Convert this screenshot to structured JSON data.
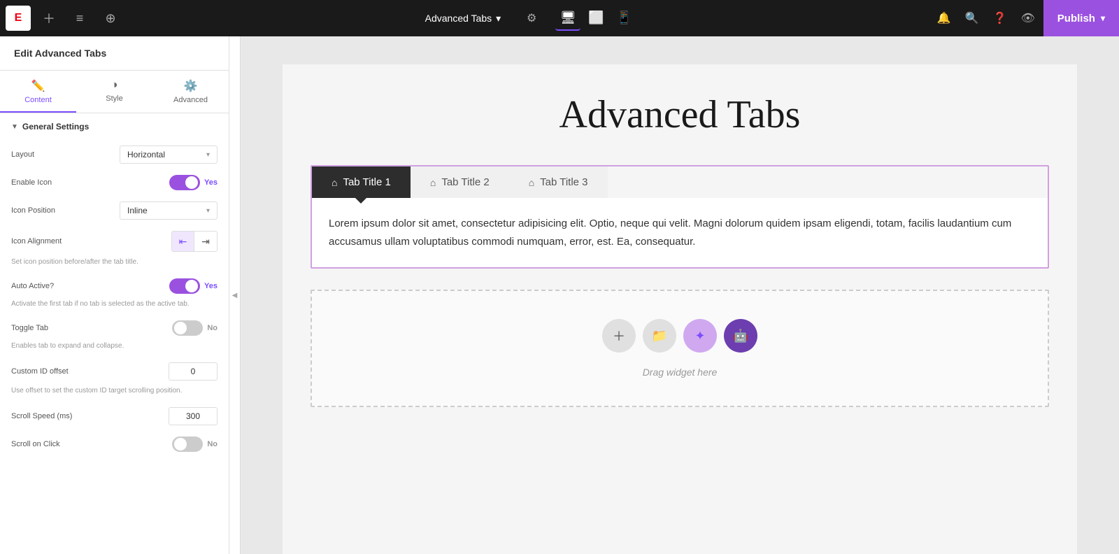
{
  "topbar": {
    "logo": "E",
    "title": "Advanced Tabs",
    "publish_label": "Publish",
    "devices": [
      "desktop",
      "tablet",
      "mobile"
    ]
  },
  "sidebar": {
    "title": "Edit Advanced Tabs",
    "tabs": [
      {
        "id": "content",
        "label": "Content",
        "icon": "✏️"
      },
      {
        "id": "style",
        "label": "Style",
        "icon": "◑"
      },
      {
        "id": "advanced",
        "label": "Advanced",
        "icon": "⚙️"
      }
    ],
    "sections": {
      "general": {
        "title": "General Settings",
        "layout_label": "Layout",
        "layout_value": "Horizontal",
        "enable_icon_label": "Enable Icon",
        "enable_icon_value": "Yes",
        "enable_icon_on": true,
        "icon_position_label": "Icon Position",
        "icon_position_value": "Inline",
        "icon_alignment_label": "Icon Alignment",
        "icon_alignment_hint": "Set icon position before/after the tab title.",
        "auto_active_label": "Auto Active?",
        "auto_active_value": "Yes",
        "auto_active_on": true,
        "auto_active_hint": "Activate the first tab if no tab is selected as the active tab.",
        "toggle_tab_label": "Toggle Tab",
        "toggle_tab_value": "No",
        "toggle_tab_on": false,
        "toggle_tab_hint": "Enables tab to expand and collapse.",
        "custom_id_offset_label": "Custom ID offset",
        "custom_id_offset_value": "0",
        "custom_id_offset_hint": "Use offset to set the custom ID target scrolling position.",
        "scroll_speed_label": "Scroll Speed (ms)",
        "scroll_speed_value": "300",
        "scroll_on_click_label": "Scroll on Click",
        "scroll_on_click_value": "No",
        "scroll_on_click_on": false
      }
    }
  },
  "canvas": {
    "title": "Advanced Tabs",
    "tabs": [
      {
        "id": "tab1",
        "label": "Tab Title 1",
        "icon": "🏠",
        "active": true
      },
      {
        "id": "tab2",
        "label": "Tab Title 2",
        "icon": "🏠",
        "active": false
      },
      {
        "id": "tab3",
        "label": "Tab Title 3",
        "icon": "🏠",
        "active": false
      }
    ],
    "tab_content": "Lorem ipsum dolor sit amet, consectetur adipisicing elit. Optio, neque qui velit. Magni dolorum quidem ipsam eligendi, totam, facilis laudantium cum accusamus ullam voluptatibus commodi numquam, error, est. Ea, consequatur.",
    "drag_label": "Drag widget here"
  }
}
